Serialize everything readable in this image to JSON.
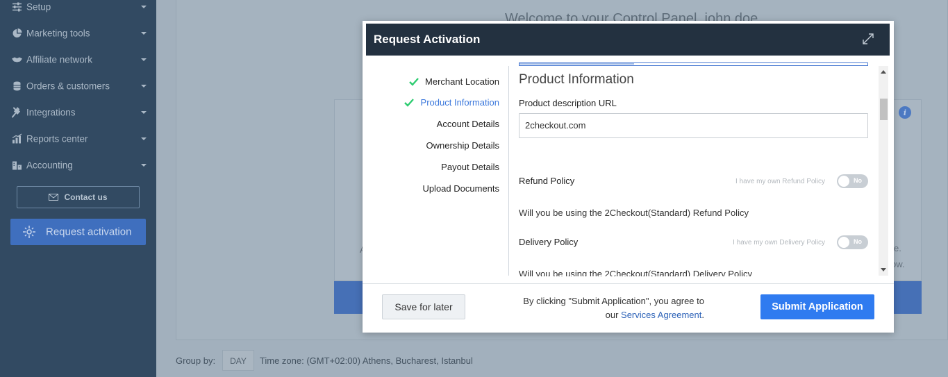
{
  "sidebar": {
    "items": [
      {
        "label": "Setup",
        "icon": "sliders-icon"
      },
      {
        "label": "Marketing tools",
        "icon": "pie-chart-icon"
      },
      {
        "label": "Affiliate network",
        "icon": "handshake-icon"
      },
      {
        "label": "Orders & customers",
        "icon": "database-icon"
      },
      {
        "label": "Integrations",
        "icon": "plug-icon"
      },
      {
        "label": "Reports center",
        "icon": "bar-chart-icon"
      },
      {
        "label": "Accounting",
        "icon": "accounting-icon"
      }
    ],
    "contact_label": "Contact us",
    "request_label": "Request activation"
  },
  "background": {
    "welcome": "Welcome to your Control Panel, john doe",
    "frag_left": "A",
    "frag_right_1": "e.",
    "frag_right_2": "ow.",
    "group_by_label": "Group by:",
    "group_by_value": "DAY",
    "timezone": "Time zone: (GMT+02:00) Athens, Bucharest, Istanbul"
  },
  "modal": {
    "title": "Request Activation",
    "steps": [
      {
        "label": "Merchant Location",
        "done": true
      },
      {
        "label": "Product Information",
        "done": true,
        "active": true
      },
      {
        "label": "Account Details",
        "done": false
      },
      {
        "label": "Ownership Details",
        "done": false
      },
      {
        "label": "Payout Details",
        "done": false
      },
      {
        "label": "Upload Documents",
        "done": false
      }
    ],
    "section_title": "Product Information",
    "product_url_label": "Product description URL",
    "product_url_value": "2checkout.com",
    "refund_policy_label": "Refund Policy",
    "refund_hint": "I have my own Refund Policy",
    "refund_toggle": "No",
    "refund_text": "Will you be using the 2Checkout(Standard) Refund Policy",
    "delivery_policy_label": "Delivery Policy",
    "delivery_hint": "I have my own Delivery Policy",
    "delivery_toggle": "No",
    "delivery_text": "Will you be using the 2Checkout(Standard) Delivery Policy",
    "save_label": "Save for later",
    "agree_text": "By clicking \"Submit Application\", you agree to",
    "agree_prefix": "our",
    "agree_link": "Services Agreement",
    "agree_suffix": ".",
    "submit_label": "Submit Application"
  },
  "colors": {
    "sidebar_bg": "#324a62",
    "header_bg": "#233140",
    "accent": "#2f7bf0",
    "check": "#2ecc71",
    "active_step": "#3b78dc"
  }
}
